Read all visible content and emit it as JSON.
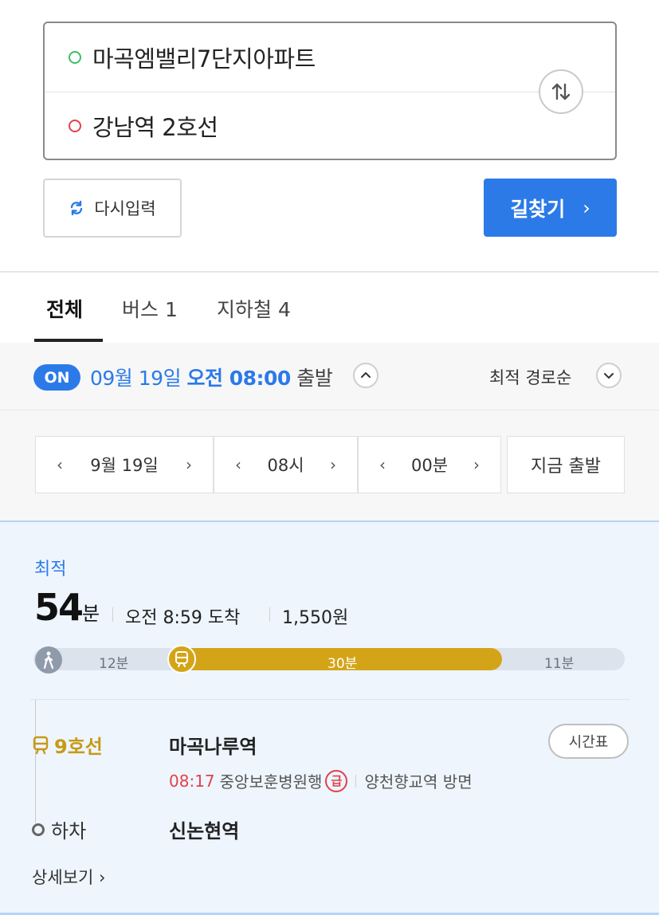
{
  "search": {
    "start": "마곡엠밸리7단지아파트",
    "end": "강남역 2호선"
  },
  "actions": {
    "reset_label": "다시입력",
    "find_label": "길찾기",
    "find_chevron": "›"
  },
  "tabs": [
    {
      "label": "전체",
      "active": true
    },
    {
      "label": "버스 1",
      "active": false
    },
    {
      "label": "지하철 4",
      "active": false
    }
  ],
  "depart": {
    "badge": "ON",
    "date": "09월 19일",
    "time": "오전 08:00",
    "suffix": "출발",
    "sort_label": "최적 경로순"
  },
  "picker": {
    "date": "9월 19일",
    "hour": "08시",
    "minute": "00분",
    "prev": "‹",
    "next": "›",
    "now_label": "지금 출발"
  },
  "route": {
    "badge": "최적",
    "duration_num": "54",
    "duration_unit": "분",
    "arrival": "오전 8:59 도착",
    "fare": "1,550원",
    "segments": {
      "walk1": "12분",
      "subway": "30분",
      "walk2": "11분"
    },
    "line_name": "9호선",
    "board_station": "마곡나루역",
    "timetable_label": "시간표",
    "next_time": "08:17",
    "train_dest": "중앙보훈병원행",
    "express_badge": "급",
    "direction": "양천향교역 방면",
    "alight_label": "하차",
    "alight_station": "신논현역",
    "detail_label": "상세보기 ›",
    "colors": {
      "line9": "#d4a418",
      "accent": "#2b7ae8",
      "red": "#e2424a"
    }
  }
}
